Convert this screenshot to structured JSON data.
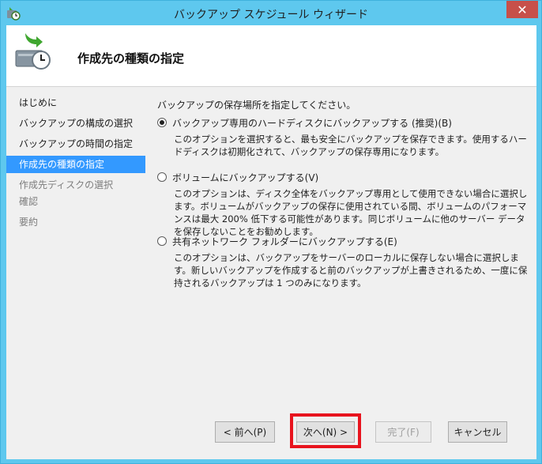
{
  "window": {
    "title": "バックアップ スケジュール ウィザード",
    "close_glyph": "✕"
  },
  "header": {
    "page_title": "作成先の種類の指定"
  },
  "nav": {
    "items": [
      {
        "label": "はじめに",
        "state": "normal"
      },
      {
        "label": "バックアップの構成の選択",
        "state": "normal"
      },
      {
        "label": "バックアップの時間の指定",
        "state": "normal"
      },
      {
        "label": "作成先の種類の指定",
        "state": "active"
      },
      {
        "label": "作成先ディスクの選択",
        "state": "disabled"
      },
      {
        "label": "確認",
        "state": "disabled"
      },
      {
        "label": "要約",
        "state": "disabled"
      }
    ]
  },
  "main": {
    "prompt": "バックアップの保存場所を指定してください。",
    "options": [
      {
        "label": "バックアップ専用のハードディスクにバックアップする (推奨)(B)",
        "checked": true,
        "description": "このオプションを選択すると、最も安全にバックアップを保存できます。使用するハードディスクは初期化されて、バックアップの保存専用になります。"
      },
      {
        "label": "ボリュームにバックアップする(V)",
        "checked": false,
        "description": "このオプションは、ディスク全体をバックアップ専用として使用できない場合に選択します。ボリュームがバックアップの保存に使用されている間、ボリュームのパフォーマンスは最大 200% 低下する可能性があります。同じボリュームに他のサーバー データを保存しないことをお勧めします。"
      },
      {
        "label": "共有ネットワーク フォルダーにバックアップする(E)",
        "checked": false,
        "description": "このオプションは、バックアップをサーバーのローカルに保存しない場合に選択します。新しいバックアップを作成すると前のバックアップが上書きされるため、一度に保持されるバックアップは 1 つのみになります。"
      }
    ]
  },
  "buttons": {
    "prev": "< 前へ(P)",
    "next": "次へ(N) >",
    "finish": "完了(F)",
    "cancel": "キャンセル"
  },
  "colors": {
    "titlebar": "#5ec8ee",
    "close_button": "#c7504a",
    "nav_active": "#3399ff",
    "highlight_box": "#e8141e"
  }
}
